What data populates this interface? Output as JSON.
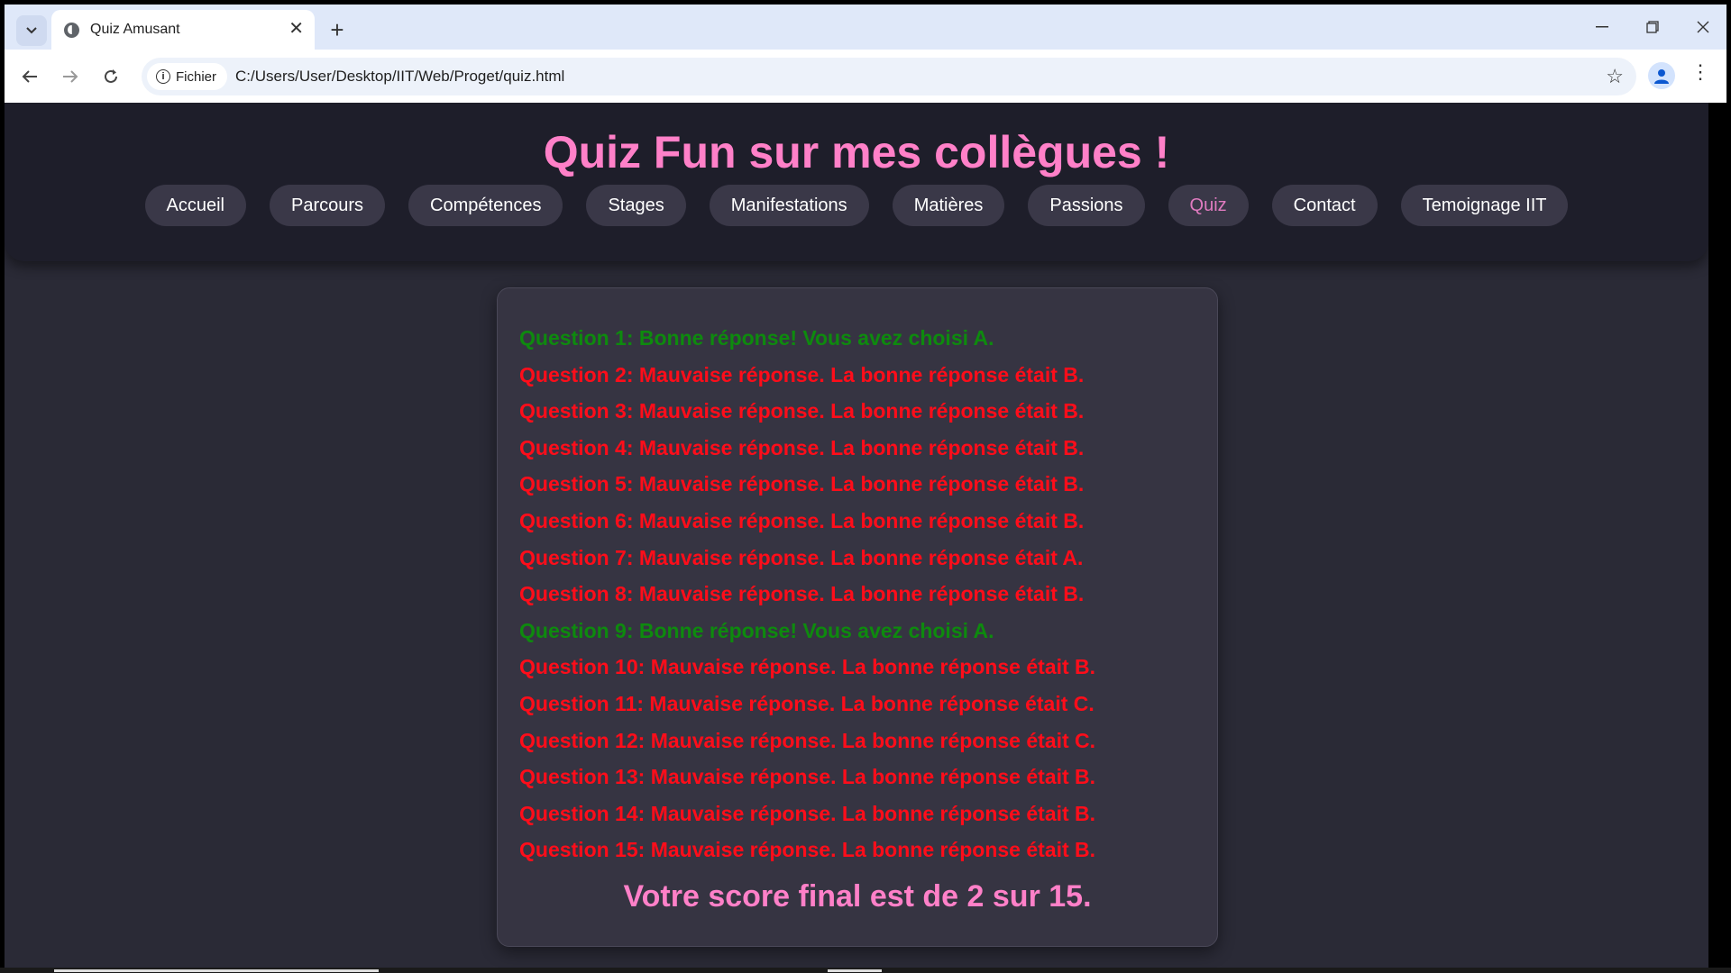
{
  "browser": {
    "tab_title": "Quiz Amusant",
    "new_tab_symbol": "+",
    "tab_close_symbol": "✕",
    "security_chip": "Fichier",
    "url": "C:/Users/User/Desktop/IIT/Web/Proget/quiz.html",
    "icons": [
      "tab-search-icon",
      "globe-favicon-icon",
      "back-icon",
      "forward-icon",
      "reload-icon",
      "info-icon",
      "star-icon",
      "profile-icon",
      "menu-icon",
      "minimize-icon",
      "restore-icon",
      "close-window-icon"
    ]
  },
  "site": {
    "title": "Quiz Fun sur mes collègues !",
    "nav": [
      {
        "label": "Accueil"
      },
      {
        "label": "Parcours"
      },
      {
        "label": "Compétences"
      },
      {
        "label": "Stages"
      },
      {
        "label": "Manifestations"
      },
      {
        "label": "Matières"
      },
      {
        "label": "Passions"
      },
      {
        "label": "Quiz",
        "active": true
      },
      {
        "label": "Contact"
      },
      {
        "label": "Temoignage IIT"
      }
    ]
  },
  "quiz": {
    "results": [
      {
        "text": "Question 1: Bonne réponse! Vous avez choisi A.",
        "correct": true
      },
      {
        "text": "Question 2: Mauvaise réponse. La bonne réponse était B.",
        "correct": false
      },
      {
        "text": "Question 3: Mauvaise réponse. La bonne réponse était B.",
        "correct": false
      },
      {
        "text": "Question 4: Mauvaise réponse. La bonne réponse était B.",
        "correct": false
      },
      {
        "text": "Question 5: Mauvaise réponse. La bonne réponse était B.",
        "correct": false
      },
      {
        "text": "Question 6: Mauvaise réponse. La bonne réponse était B.",
        "correct": false
      },
      {
        "text": "Question 7: Mauvaise réponse. La bonne réponse était A.",
        "correct": false
      },
      {
        "text": "Question 8: Mauvaise réponse. La bonne réponse était B.",
        "correct": false
      },
      {
        "text": "Question 9: Bonne réponse! Vous avez choisi A.",
        "correct": true
      },
      {
        "text": "Question 10: Mauvaise réponse. La bonne réponse était B.",
        "correct": false
      },
      {
        "text": "Question 11: Mauvaise réponse. La bonne réponse était C.",
        "correct": false
      },
      {
        "text": "Question 12: Mauvaise réponse. La bonne réponse était C.",
        "correct": false
      },
      {
        "text": "Question 13: Mauvaise réponse. La bonne réponse était B.",
        "correct": false
      },
      {
        "text": "Question 14: Mauvaise réponse. La bonne réponse était B.",
        "correct": false
      },
      {
        "text": "Question 15: Mauvaise réponse. La bonne réponse était B.",
        "correct": false
      }
    ],
    "final_score": "Votre score final est de 2 sur 15."
  },
  "colors": {
    "accent_pink": "#ff80c8",
    "correct_green": "#0e8a0e",
    "wrong_red": "#ff0d1a",
    "page_bg": "#2a2a36",
    "header_bg": "#1e1e2a"
  }
}
